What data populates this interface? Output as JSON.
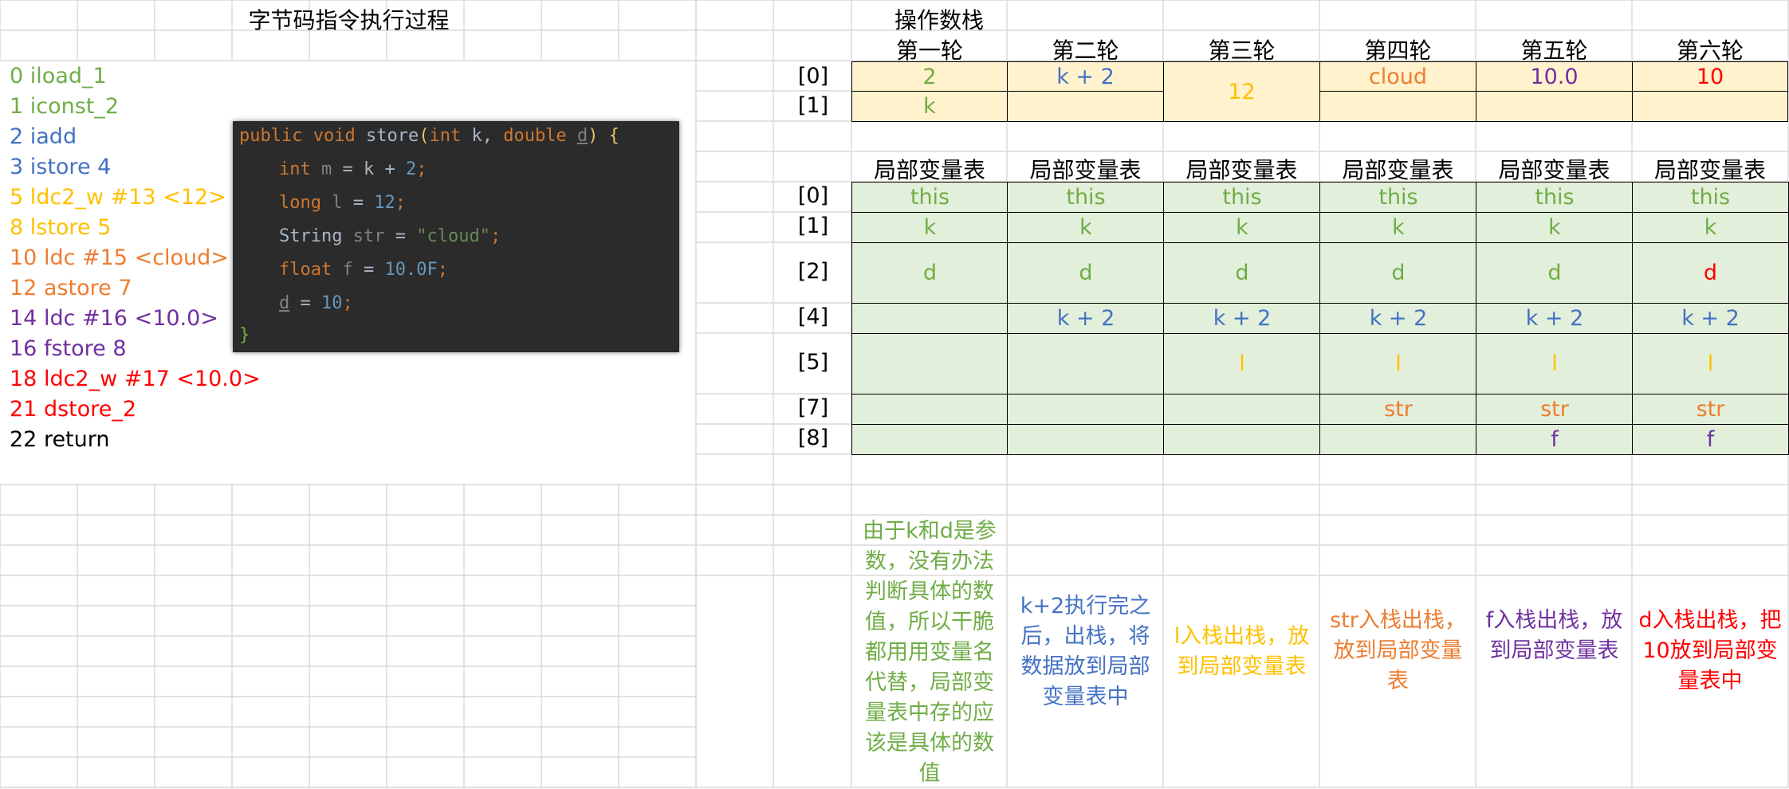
{
  "colors": {
    "green": "#70ad47",
    "blue": "#4472c4",
    "yellow": "#ffc000",
    "orange": "#ed7d31",
    "purple": "#7030a0",
    "red": "#ff0000",
    "black": "#000000"
  },
  "left_title": "字节码指令执行过程",
  "bytecode": [
    {
      "text": "0 iload_1",
      "color": "green"
    },
    {
      "text": "1 iconst_2",
      "color": "green"
    },
    {
      "text": "2 iadd",
      "color": "blue"
    },
    {
      "text": "3 istore 4",
      "color": "blue"
    },
    {
      "text": "5 ldc2_w #13 <12>",
      "color": "yellow"
    },
    {
      "text": "8 lstore 5",
      "color": "yellow"
    },
    {
      "text": "10 ldc #15 <cloud>",
      "color": "orange"
    },
    {
      "text": "12 astore 7",
      "color": "orange"
    },
    {
      "text": "14 ldc #16 <10.0>",
      "color": "purple"
    },
    {
      "text": "16 fstore 8",
      "color": "purple"
    },
    {
      "text": "18 ldc2_w #17 <10.0>",
      "color": "red"
    },
    {
      "text": "21 dstore_2",
      "color": "red"
    },
    {
      "text": "22 return",
      "color": "black"
    }
  ],
  "code": {
    "l1a": "public",
    "l1b": "void",
    "l1c": "store",
    "l1d": "(",
    "l1e": "int",
    "l1f": "k,",
    "l1g": "double",
    "l1h": "d",
    ") {": ") {",
    "l1i": ") {",
    "l2a": "int",
    "l2b": "m",
    "l2c": "= k +",
    "l2d": "2",
    "l2e": ";",
    "l3a": "long",
    "l3b": "l",
    "l3c": "=",
    "l3d": "12",
    "l3e": ";",
    "l4a": "String",
    "l4b": "str",
    "l4c": "=",
    "l4d": "\"cloud\"",
    "l4e": ";",
    "l5a": "float",
    "l5b": "f",
    "l5c": "=",
    "l5d": "10.0F",
    "l5e": ";",
    "l6a": "d",
    "l6b": "=",
    "l6c": "10",
    "l6d": ";",
    "l7": "}"
  },
  "stack_title": "操作数栈",
  "rounds": [
    "第一轮",
    "第二轮",
    "第三轮",
    "第四轮",
    "第五轮",
    "第六轮"
  ],
  "stack_idx": [
    "[0]",
    "[1]"
  ],
  "stack": {
    "r1_0": "2",
    "r1_1": "k",
    "r2_0": "k + 2",
    "r3": "12",
    "r4_0": "cloud",
    "r5_0": "10.0",
    "r6_0": "10"
  },
  "lvt_header": "局部变量表",
  "lvt_idx": [
    "[0]",
    "[1]",
    "[2]",
    "[4]",
    "[5]",
    "[7]",
    "[8]"
  ],
  "lvt": {
    "this": "this",
    "k": "k",
    "d": "d",
    "k2": "k + 2",
    "l": "l",
    "str": "str",
    "f": "f"
  },
  "notes": [
    "由于k和d是参数，没有办法判断具体的数值，所以干脆都用用变量名代替，局部变量表中存的应该是具体的数值",
    "k+2执行完之后，出栈，将数据放到局部变量表中",
    "l入栈出栈，放到局部变量表",
    "str入栈出栈，放到局部变量表",
    "f入栈出栈，放到局部变量表",
    "d入栈出栈，把10放到局部变量表中"
  ]
}
